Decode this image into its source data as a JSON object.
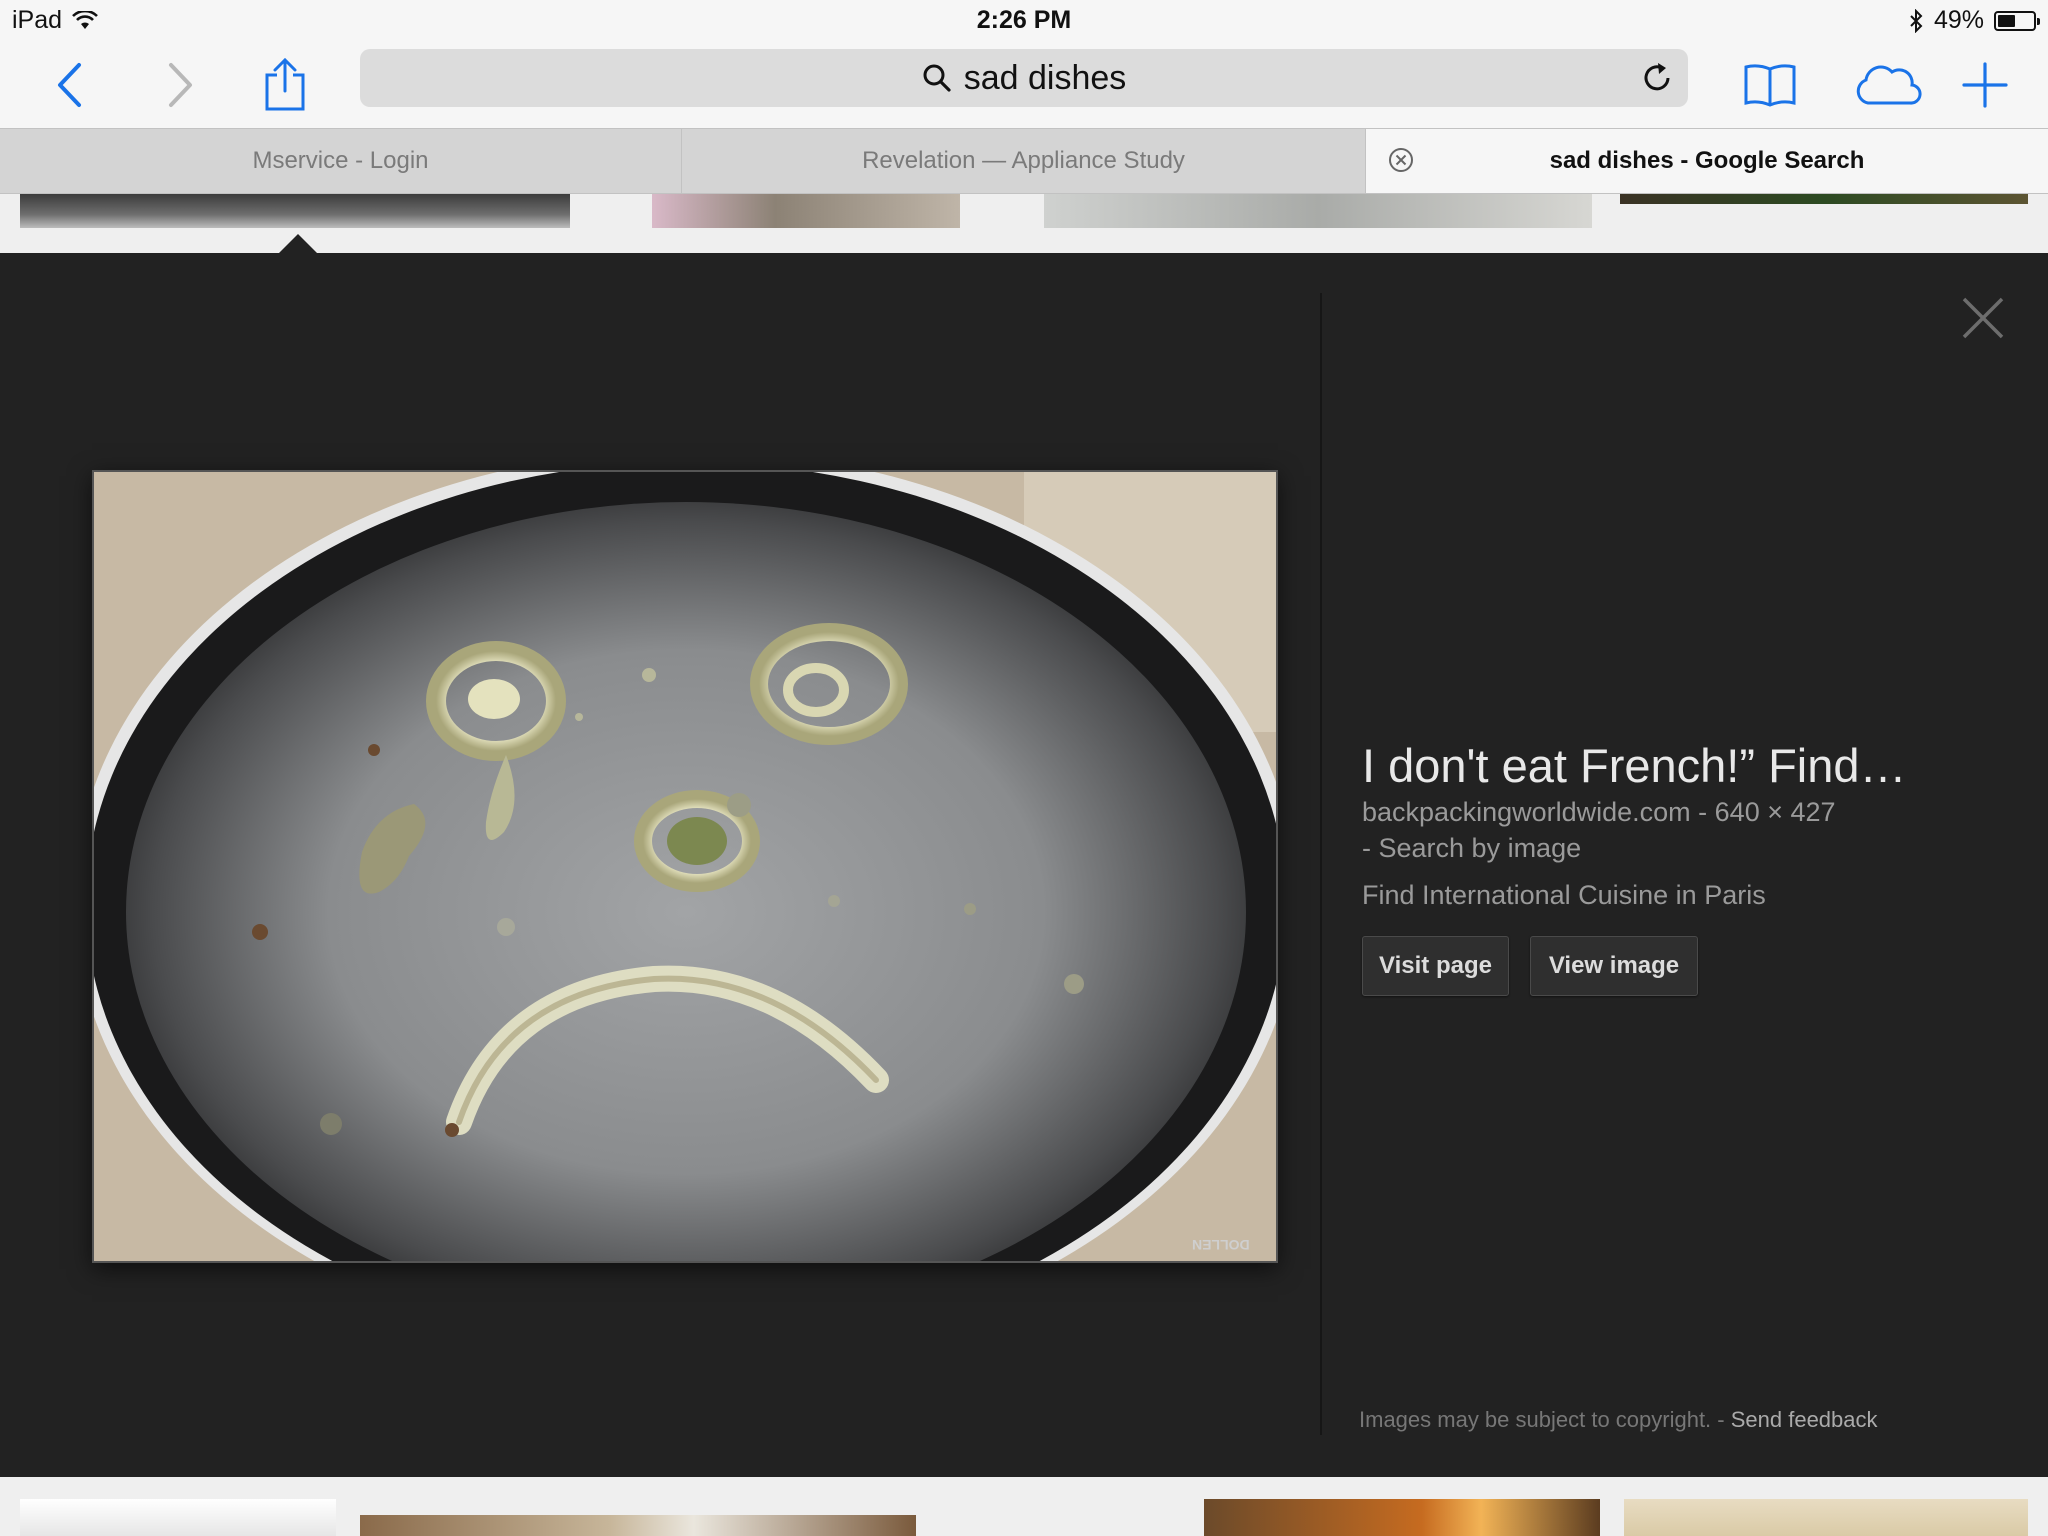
{
  "status_bar": {
    "device": "iPad",
    "time": "2:26 PM",
    "battery": "49%",
    "battery_level": 0.49
  },
  "toolbar": {
    "search_text": "sad dishes",
    "icons": [
      "back-icon",
      "forward-icon",
      "share-icon",
      "search-icon",
      "reload-icon",
      "bookmarks-icon",
      "icloud-tabs-icon",
      "new-tab-icon"
    ]
  },
  "tabs": [
    {
      "label": "Mservice - Login",
      "active": false
    },
    {
      "label": "Revelation — Appliance Study",
      "active": false
    },
    {
      "label": "sad dishes - Google Search",
      "active": true
    }
  ],
  "detail": {
    "title": "I don't eat French!” Find…",
    "source_domain": "backpackingworldwide.com",
    "separator": " - ",
    "dimensions": "640 × 427",
    "search_by_image": "Search by image",
    "description": "Find International Cuisine in Paris",
    "visit_page_label": "Visit page",
    "view_image_label": "View image",
    "copyright_note": "Images may be subject to copyright.",
    "send_feedback": "Send feedback",
    "watermark": "DOLLEN"
  },
  "colors": {
    "accent_blue": "#1a73e8",
    "panel_bg": "#222222",
    "toolbar_bg": "#f6f6f6"
  }
}
